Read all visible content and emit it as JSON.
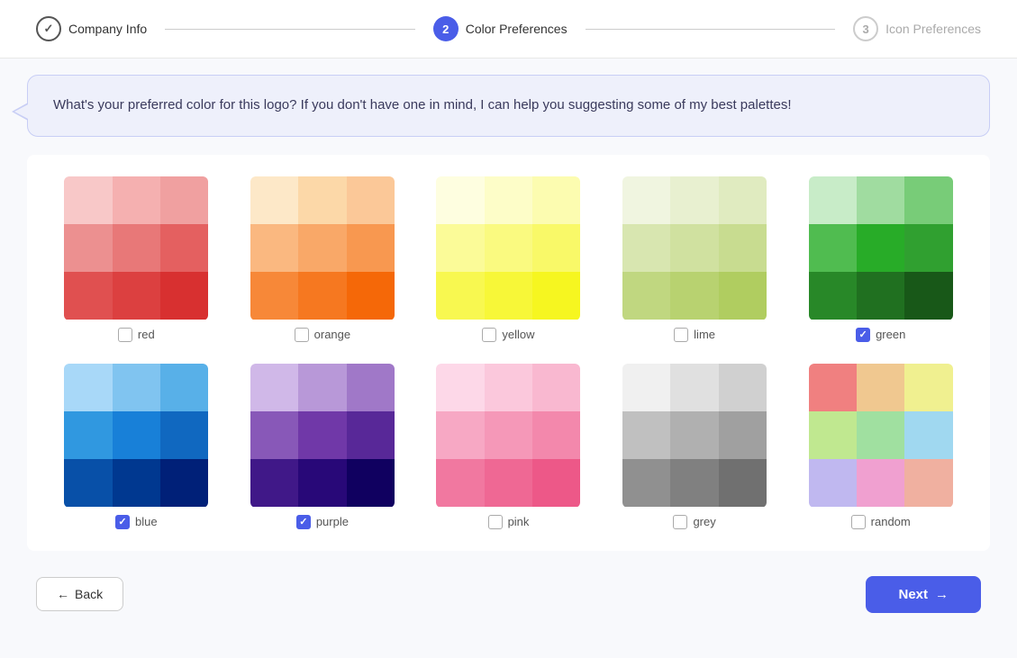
{
  "stepper": {
    "steps": [
      {
        "id": "company-info",
        "number": "✓",
        "label": "Company Info",
        "state": "done"
      },
      {
        "id": "color-preferences",
        "number": "2",
        "label": "Color Preferences",
        "state": "active"
      },
      {
        "id": "icon-preferences",
        "number": "3",
        "label": "Icon Preferences",
        "state": "inactive"
      }
    ]
  },
  "chat": {
    "message": "What's your preferred color for this logo? If you don't have one in mind, I can help you suggesting some of my best palettes!"
  },
  "colors": [
    {
      "id": "red",
      "label": "red",
      "checked": false,
      "cells": [
        "#f8c8c8",
        "#f5b0b0",
        "#f0a0a0",
        "#ec9090",
        "#e87878",
        "#e46060",
        "#e05050",
        "#dc4040",
        "#d83030"
      ]
    },
    {
      "id": "orange",
      "label": "orange",
      "checked": false,
      "cells": [
        "#fde8c8",
        "#fcd8a8",
        "#fbc898",
        "#fab880",
        "#f9a868",
        "#f89850",
        "#f78838",
        "#f67820",
        "#f56808"
      ]
    },
    {
      "id": "yellow",
      "label": "yellow",
      "checked": false,
      "cells": [
        "#fefee0",
        "#fdfdc8",
        "#fcfcb0",
        "#fbfb98",
        "#fafa80",
        "#f9f968",
        "#f8f850",
        "#f7f738",
        "#f6f620"
      ]
    },
    {
      "id": "lime",
      "label": "lime",
      "checked": false,
      "cells": [
        "#f0f5e0",
        "#e8f0d0",
        "#e0ebc0",
        "#d8e6b0",
        "#d0e1a0",
        "#c8dc90",
        "#c0d780",
        "#b8d270",
        "#b0cd60"
      ]
    },
    {
      "id": "green",
      "label": "green",
      "checked": true,
      "cells": [
        "#c8ecc8",
        "#a0dca0",
        "#78cc78",
        "#50bc50",
        "#28ac28",
        "#30a030",
        "#288828",
        "#207020",
        "#185818"
      ]
    },
    {
      "id": "blue",
      "label": "blue",
      "checked": true,
      "cells": [
        "#a8d8f8",
        "#80c4f0",
        "#58b0e8",
        "#3098e0",
        "#1880d8",
        "#1068c0",
        "#0850a8",
        "#003890",
        "#002078"
      ]
    },
    {
      "id": "purple",
      "label": "purple",
      "checked": true,
      "cells": [
        "#d0b8e8",
        "#b898d8",
        "#a078c8",
        "#8858b8",
        "#7038a8",
        "#582898",
        "#401888",
        "#280878",
        "#100060"
      ]
    },
    {
      "id": "pink",
      "label": "pink",
      "checked": false,
      "cells": [
        "#fdd8e8",
        "#fbc8dc",
        "#f9b8d0",
        "#f7a8c4",
        "#f598b8",
        "#f388ac",
        "#f178a0",
        "#ef6894",
        "#ed5888"
      ]
    },
    {
      "id": "grey",
      "label": "grey",
      "checked": false,
      "cells": [
        "#f0f0f0",
        "#e0e0e0",
        "#d0d0d0",
        "#c0c0c0",
        "#b0b0b0",
        "#a0a0a0",
        "#909090",
        "#808080",
        "#707070"
      ]
    },
    {
      "id": "random",
      "label": "random",
      "checked": false,
      "cells": [
        "#f08080",
        "#f0c890",
        "#f0f090",
        "#c0e890",
        "#a0e0a0",
        "#a0d8f0",
        "#c0b8f0",
        "#f0a0d0",
        "#f0b0a0"
      ]
    }
  ],
  "footer": {
    "back_label": "Back",
    "next_label": "Next",
    "back_arrow": "←",
    "next_arrow": "→"
  }
}
